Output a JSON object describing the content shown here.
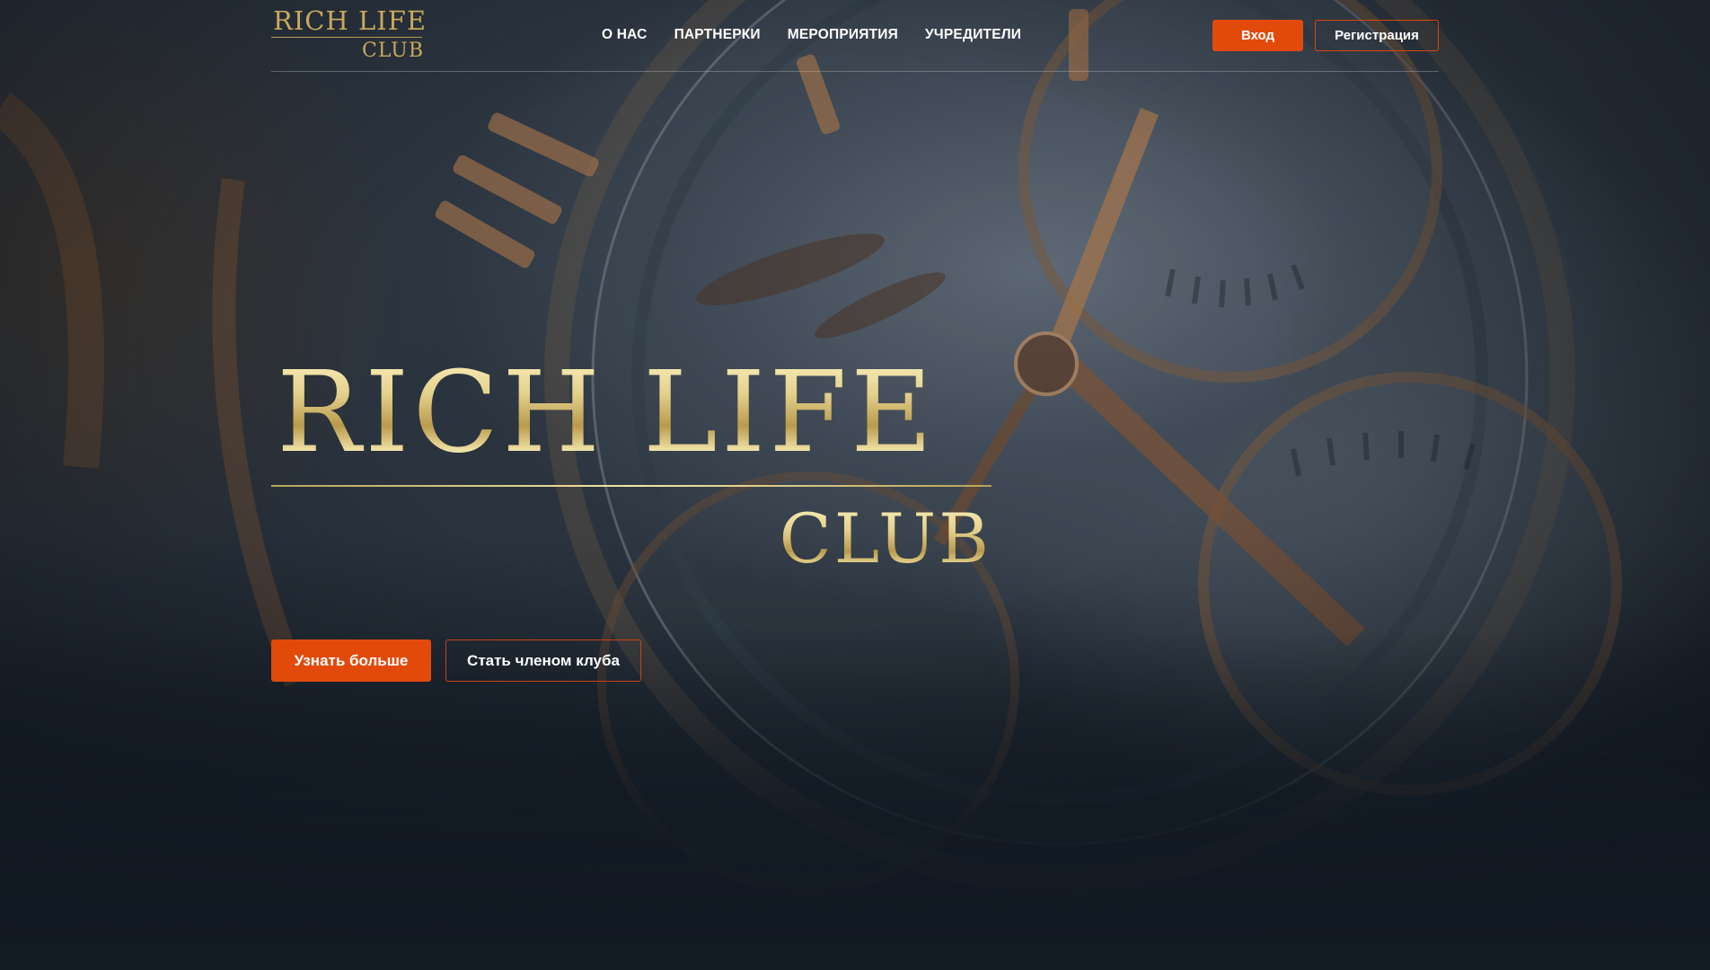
{
  "logo": {
    "line1": "RICH LIFE",
    "line2": "CLUB"
  },
  "nav": {
    "items": [
      {
        "label": "О НАС"
      },
      {
        "label": "ПАРТНЕРКИ"
      },
      {
        "label": "МЕРОПРИЯТИЯ"
      },
      {
        "label": "УЧРЕДИТЕЛИ"
      }
    ]
  },
  "auth": {
    "login_label": "Вход",
    "register_label": "Регистрация"
  },
  "hero": {
    "title_line1": "RICH LIFE",
    "title_line2": "CLUB",
    "primary_button": "Узнать больше",
    "secondary_button": "Стать членом клуба"
  },
  "colors": {
    "accent": "#e24a0c",
    "gold": "#d8c98a",
    "background": "#121a24"
  }
}
